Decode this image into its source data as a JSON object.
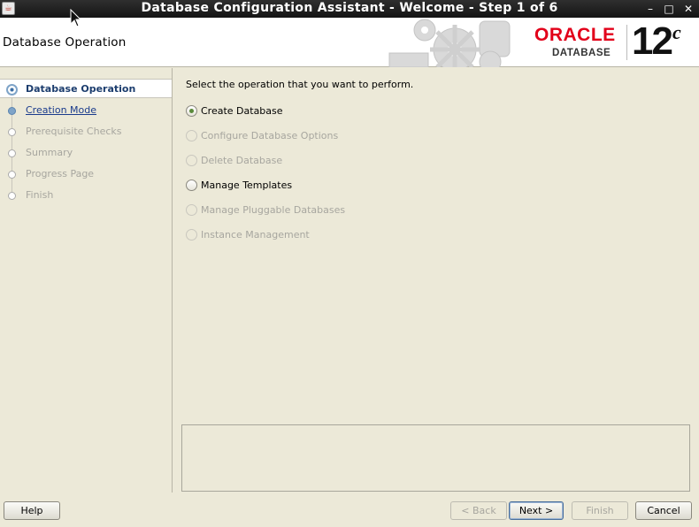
{
  "window": {
    "title": "Database Configuration Assistant - Welcome - Step 1 of 6",
    "controls": {
      "minimize": "–",
      "maximize": "□",
      "close": "✕"
    },
    "app_icon": "java-icon"
  },
  "header": {
    "section_title": "Database Operation",
    "brand": {
      "oracle": "ORACLE",
      "database": "DATABASE",
      "version": "12",
      "edition": "c"
    },
    "colors": {
      "oracle_red": "#e2001a"
    }
  },
  "nav": {
    "items": [
      {
        "label": "Database Operation",
        "state": "current"
      },
      {
        "label": "Creation Mode",
        "state": "link"
      },
      {
        "label": "Prerequisite Checks",
        "state": "disabled"
      },
      {
        "label": "Summary",
        "state": "disabled"
      },
      {
        "label": "Progress Page",
        "state": "disabled"
      },
      {
        "label": "Finish",
        "state": "disabled"
      }
    ]
  },
  "main": {
    "prompt": "Select the operation that you want to perform.",
    "options": [
      {
        "label": "Create Database",
        "selected": true,
        "enabled": true
      },
      {
        "label": "Configure Database Options",
        "selected": false,
        "enabled": false
      },
      {
        "label": "Delete Database",
        "selected": false,
        "enabled": false
      },
      {
        "label": "Manage Templates",
        "selected": false,
        "enabled": true
      },
      {
        "label": "Manage Pluggable Databases",
        "selected": false,
        "enabled": false
      },
      {
        "label": "Instance Management",
        "selected": false,
        "enabled": false
      }
    ]
  },
  "footer": {
    "help": "Help",
    "back": "< Back",
    "next": "Next >",
    "finish": "Finish",
    "cancel": "Cancel"
  }
}
